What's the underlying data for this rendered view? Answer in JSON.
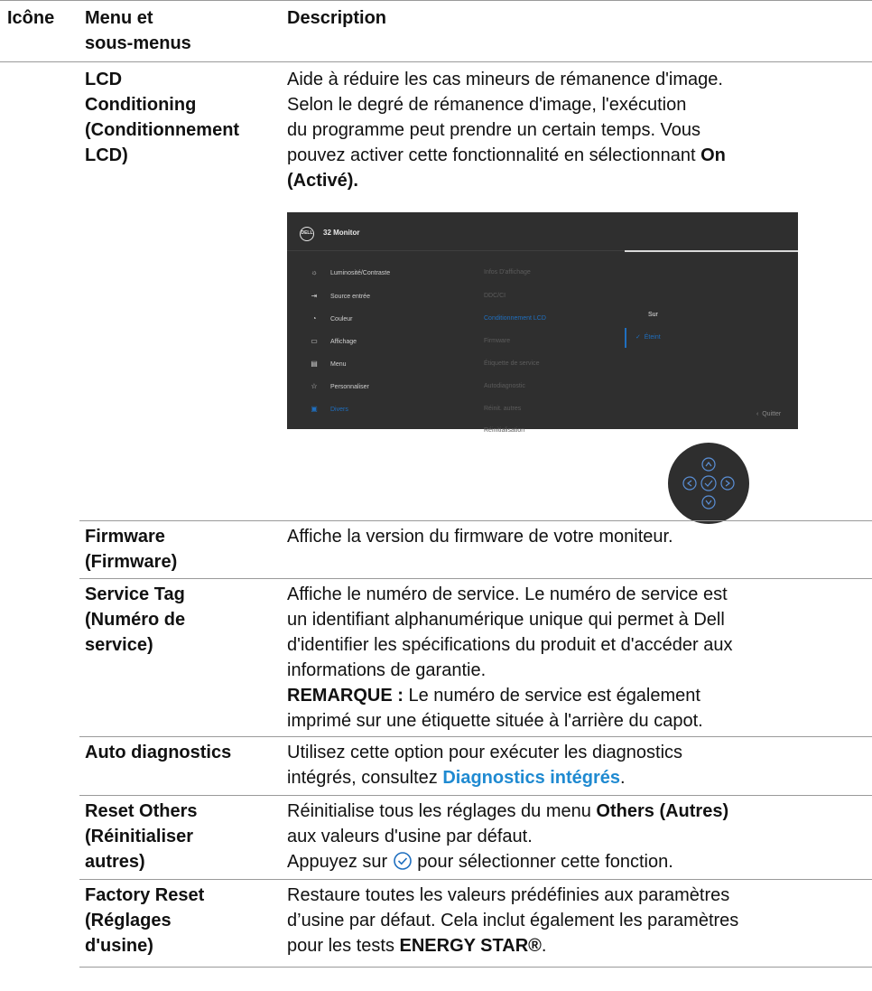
{
  "header": {
    "col_icon": "Icône",
    "col_menu_line1": "Menu et",
    "col_menu_line2": "sous-menus",
    "col_desc": "Description"
  },
  "rows": {
    "lcd": {
      "menu": [
        "LCD",
        "Conditioning",
        "(Conditionnement",
        "LCD)"
      ],
      "desc": [
        "Aide à réduire les cas mineurs de rémanence d'image.",
        "Selon le degré de rémanence d'image, l'exécution",
        "du programme peut prendre un certain temps. Vous",
        "pouvez activer cette fonctionnalité en sélectionnant"
      ],
      "desc_bold_on": "On",
      "desc_bold_active": "(Activé)."
    },
    "firmware": {
      "menu": [
        "Firmware",
        "(Firmware)"
      ],
      "desc": "Affiche la version du firmware de votre moniteur."
    },
    "service_tag": {
      "menu": [
        "Service Tag",
        "(Numéro de",
        "service)"
      ],
      "desc": [
        "Affiche le numéro de service. Le numéro de service est",
        "un identifiant alphanumérique unique qui permet à Dell",
        "d'identifier les spécifications du produit et d'accéder aux",
        "informations de garantie."
      ],
      "note_label": "REMARQUE :",
      "note_text": " Le numéro de service est également",
      "note_line2": "imprimé sur une étiquette située à l'arrière du capot."
    },
    "auto_diag": {
      "menu": "Auto diagnostics",
      "desc_line1": "Utilisez cette option pour exécuter les diagnostics",
      "desc_line2_pre": "intégrés, consultez ",
      "desc_link": "Diagnostics intégrés",
      "desc_line2_post": "."
    },
    "reset_others": {
      "menu": [
        "Reset Others",
        "(Réinitialiser",
        "autres)"
      ],
      "desc_line1_pre": "Réinitialise tous les réglages du menu ",
      "desc_line1_bold": "Others (Autres)",
      "desc_line2": "aux valeurs d'usine par défaut.",
      "desc_line3_pre": "Appuyez sur ",
      "desc_line3_post": " pour sélectionner cette fonction."
    },
    "factory_reset": {
      "menu": [
        "Factory Reset",
        "(Réglages",
        "d'usine)"
      ],
      "desc_line1": "Restaure toutes les valeurs prédéfinies aux paramètres",
      "desc_line2": "d’usine par défaut. Cela inclut également les paramètres",
      "desc_line3_pre": "pour les tests ",
      "desc_line3_bold": "ENERGY STAR®",
      "desc_line3_post": "."
    }
  },
  "osd": {
    "logo": "DELL",
    "title": "32 Monitor",
    "left_menu": [
      {
        "label": "Luminosité/Contraste",
        "icon": "brightness-icon"
      },
      {
        "label": "Source entrée",
        "icon": "input-source-icon"
      },
      {
        "label": "Couleur",
        "icon": "color-icon"
      },
      {
        "label": "Affichage",
        "icon": "display-icon"
      },
      {
        "label": "Menu",
        "icon": "menu-icon"
      },
      {
        "label": "Personnaliser",
        "icon": "star-icon"
      },
      {
        "label": "Divers",
        "icon": "others-icon"
      }
    ],
    "mid_menu": [
      "Infos D'affichage",
      "DDC/CI",
      "Conditionnement LCD",
      "Firmware",
      "Étiquette de service",
      "Autodiagnostic",
      "Réinit. autres",
      "Réinitialisation"
    ],
    "right_options": [
      "Sur",
      "Éteint"
    ],
    "quit": "Quitter",
    "accent_color": "#1f6fbf"
  }
}
